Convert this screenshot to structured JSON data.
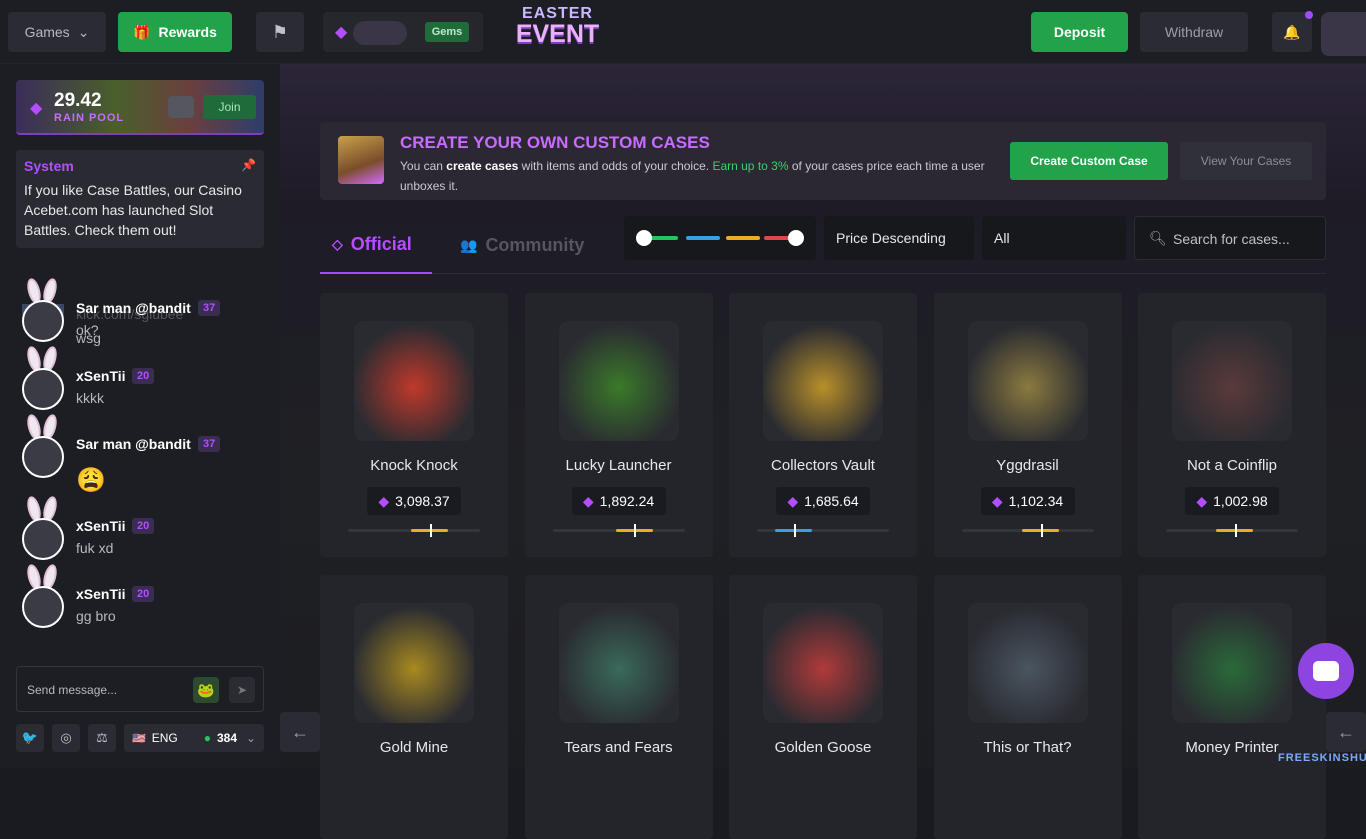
{
  "header": {
    "games_label": "Games",
    "rewards_label": "Rewards",
    "gems_tag": "Gems",
    "event_line1": "EASTER",
    "event_line2": "EVENT",
    "deposit_label": "Deposit",
    "withdraw_label": "Withdraw"
  },
  "rain": {
    "amount": "29.42",
    "label": "RAIN POOL",
    "join_label": "Join"
  },
  "system": {
    "title": "System",
    "message": "If you like Case Battles, our Casino Acebet.com has launched Slot Battles. Check them out!"
  },
  "chat": {
    "partial": {
      "name": "kick.com/sgiubee",
      "text": "wsg"
    },
    "messages": [
      {
        "name": "Sar man @bandit",
        "level": "37",
        "text": "ok?"
      },
      {
        "name": "xSenTii",
        "level": "20",
        "text": "kkkk"
      },
      {
        "name": "Sar man @bandit",
        "level": "37",
        "text": "😩"
      },
      {
        "name": "xSenTii",
        "level": "20",
        "text": "fuk xd"
      },
      {
        "name": "xSenTii",
        "level": "20",
        "text": "gg bro"
      }
    ],
    "input_placeholder": "Send message..."
  },
  "footer": {
    "lang": "ENG",
    "online": "384"
  },
  "banner": {
    "title": "CREATE YOUR OWN CUSTOM CASES",
    "desc_pre": "You can ",
    "desc_bold": "create cases",
    "desc_mid": " with items and odds of your choice. ",
    "desc_green": "Earn up to 3%",
    "desc_post": " of your cases price each time a user unboxes it.",
    "create_label": "Create Custom Case",
    "view_label": "View Your Cases"
  },
  "tabs": {
    "official": "Official",
    "community": "Community"
  },
  "filters": {
    "sort": "Price Descending",
    "category": "All",
    "search_placeholder": "Search for cases..."
  },
  "cases": [
    {
      "name": "Knock Knock",
      "price": "3,098.37",
      "color": "#e8b020",
      "pos": 0.62
    },
    {
      "name": "Lucky Launcher",
      "price": "1,892.24",
      "color": "#e8b020",
      "pos": 0.62
    },
    {
      "name": "Collectors Vault",
      "price": "1,685.64",
      "color": "#3aa0e0",
      "pos": 0.28
    },
    {
      "name": "Yggdrasil",
      "price": "1,102.34",
      "color": "#e8b020",
      "pos": 0.6
    },
    {
      "name": "Not a Coinflip",
      "price": "1,002.98",
      "color": "#e8b020",
      "pos": 0.52
    },
    {
      "name": "Gold Mine",
      "price": ""
    },
    {
      "name": "Tears and Fears",
      "price": ""
    },
    {
      "name": "Golden Goose",
      "price": ""
    },
    {
      "name": "This or That?",
      "price": ""
    },
    {
      "name": "Money Printer",
      "price": ""
    }
  ],
  "watermark": "FREESKINSHUB"
}
